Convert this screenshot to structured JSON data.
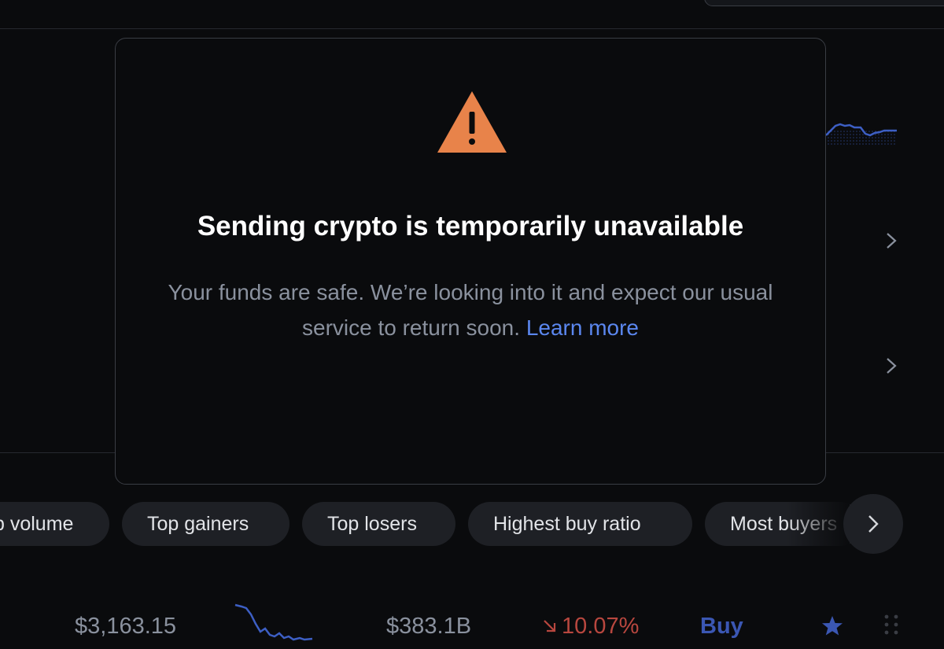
{
  "modal": {
    "icon": "warning-triangle-icon",
    "title": "Sending crypto is temporarily unavailable",
    "body": "Your funds are safe. We’re looking into it and expect our usual service to return soon.",
    "link": "Learn more"
  },
  "filters": {
    "chips": [
      "p volume",
      "Top gainers",
      "Top losers",
      "Highest buy ratio",
      "Most buyers"
    ]
  },
  "asset_row": {
    "price": "$3,163.15",
    "market_cap": "$383.1B",
    "change": "10.07%",
    "change_icon": "arrow-down-right-icon",
    "buy_label": "Buy"
  },
  "colors": {
    "background": "#0a0b0d",
    "warning": "#e8834a",
    "link": "#5b87ef",
    "negative": "#b8473f",
    "accent": "#3b57b3"
  }
}
